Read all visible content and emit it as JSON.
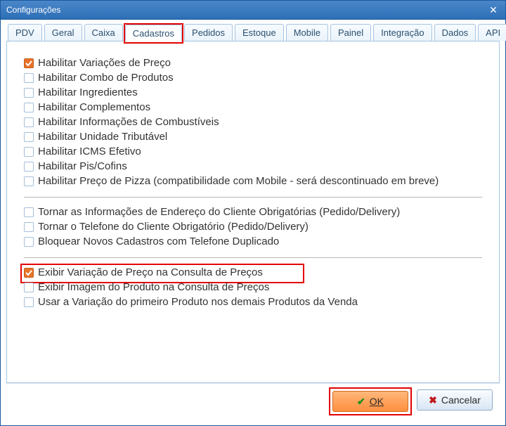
{
  "window": {
    "title": "Configurações"
  },
  "tabs": [
    {
      "label": "PDV"
    },
    {
      "label": "Geral"
    },
    {
      "label": "Caixa"
    },
    {
      "label": "Cadastros",
      "active": true,
      "highlight": true
    },
    {
      "label": "Pedidos"
    },
    {
      "label": "Estoque"
    },
    {
      "label": "Mobile"
    },
    {
      "label": "Painel"
    },
    {
      "label": "Integração"
    },
    {
      "label": "Dados"
    },
    {
      "label": "API"
    }
  ],
  "groups": [
    [
      {
        "label": "Habilitar Variações de Preço",
        "checked": true
      },
      {
        "label": "Habilitar Combo de Produtos",
        "checked": false
      },
      {
        "label": "Habilitar Ingredientes",
        "checked": false
      },
      {
        "label": "Habilitar Complementos",
        "checked": false
      },
      {
        "label": "Habilitar Informações de Combustíveis",
        "checked": false
      },
      {
        "label": "Habilitar Unidade Tributável",
        "checked": false
      },
      {
        "label": "Habilitar ICMS Efetivo",
        "checked": false
      },
      {
        "label": "Habilitar Pis/Cofins",
        "checked": false
      },
      {
        "label": "Habilitar Preço de Pizza (compatibilidade com Mobile - será descontinuado em breve)",
        "checked": false
      }
    ],
    [
      {
        "label": "Tornar as Informações de Endereço do Cliente Obrigatórias (Pedido/Delivery)",
        "checked": false
      },
      {
        "label": "Tornar o Telefone do Cliente Obrigatório (Pedido/Delivery)",
        "checked": false
      },
      {
        "label": "Bloquear Novos Cadastros com Telefone Duplicado",
        "checked": false
      }
    ],
    [
      {
        "label": "Exibir Variação de Preço na Consulta de Preços",
        "checked": true,
        "highlight": true
      },
      {
        "label": "Exibir Imagem do Produto na Consulta de Preços",
        "checked": false
      },
      {
        "label": "Usar a Variação do primeiro Produto nos demais Produtos da Venda",
        "checked": false
      }
    ]
  ],
  "buttons": {
    "ok": "OK",
    "cancel": "Cancelar"
  },
  "icons": {
    "close": "✕",
    "ok": "✔",
    "cancel": "✖"
  }
}
